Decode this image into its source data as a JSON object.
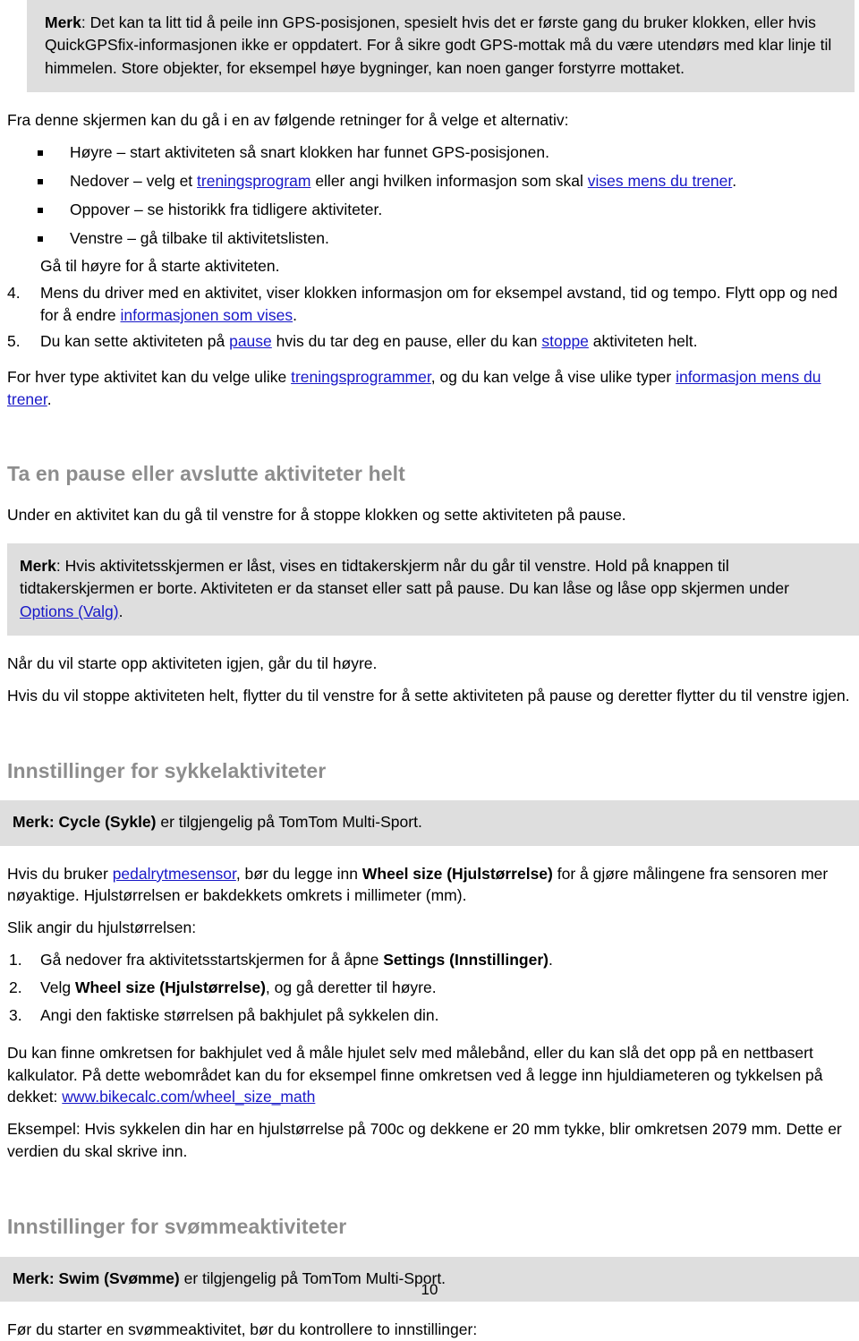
{
  "document": {
    "page_number": "10"
  },
  "note_gps": {
    "label": "Merk",
    "colon": ": ",
    "text": "Det kan ta litt tid å peile inn GPS-posisjonen, spesielt hvis det er første gang du bruker klokken, eller hvis QuickGPSfix-informasjonen ikke er oppdatert. For å sikre godt GPS-mottak må du være utendørs med klar linje til himmelen. Store objekter, for eksempel høye bygninger, kan noen ganger forstyrre mottaket."
  },
  "directions": {
    "intro": "Fra denne skjermen kan du gå i en av følgende retninger for å velge et alternativ:",
    "items": [
      {
        "pre": "Høyre – start aktiviteten så snart klokken har funnet GPS-posisjonen.",
        "link1": "",
        "mid": "",
        "link2": "",
        "post": ""
      },
      {
        "pre": "Nedover – velg et ",
        "link1": "treningsprogram",
        "mid": " eller angi hvilken informasjon som skal ",
        "link2": "vises mens du trener",
        "post": "."
      },
      {
        "pre": "Oppover – se historikk fra tidligere aktiviteter.",
        "link1": "",
        "mid": "",
        "link2": "",
        "post": ""
      },
      {
        "pre": "Venstre – gå tilbake til aktivitetslisten.",
        "link1": "",
        "mid": "",
        "link2": "",
        "post": ""
      }
    ],
    "closing": "Gå til høyre for å starte aktiviteten."
  },
  "steps": [
    {
      "number": "4.",
      "pre": "Mens du driver med en aktivitet, viser klokken informasjon om for eksempel avstand, tid og tempo. Flytt opp og ned for å endre ",
      "link1": "informasjonen som vises",
      "mid": "",
      "link2": "",
      "post": "."
    },
    {
      "number": "5.",
      "pre": "Du kan sette aktiviteten på ",
      "link1": "pause",
      "mid": " hvis du tar deg en pause, eller du kan ",
      "link2": "stoppe",
      "post": " aktiviteten helt."
    }
  ],
  "programs_para": {
    "pre": "For hver type aktivitet kan du velge ulike ",
    "link1": "treningsprogrammer",
    "mid": ", og du kan velge å vise ulike typer ",
    "link2": "informasjon mens du trener",
    "post": "."
  },
  "pause_section": {
    "heading": "Ta en pause eller avslutte aktiviteter helt",
    "intro": "Under en aktivitet kan du gå til venstre for å stoppe klokken og sette aktiviteten på pause.",
    "note": {
      "label": "Merk",
      "colon": ": ",
      "pre": "Hvis aktivitetsskjermen er låst, vises en tidtakerskjerm når du går til venstre. Hold på knappen til tidtakerskjermen er borte. Aktiviteten er da stanset eller satt på pause. Du kan låse og låse opp skjermen under ",
      "link": "Options (Valg)",
      "post": "."
    },
    "resume": "Når du vil starte opp aktiviteten igjen, går du til høyre.",
    "stop": "Hvis du vil stoppe aktiviteten helt, flytter du til venstre for å sette aktiviteten på pause og deretter flytter du til venstre igjen."
  },
  "bike_section": {
    "heading": "Innstillinger for sykkelaktiviteter",
    "note": {
      "label": "Merk: ",
      "bold_term": "Cycle (Sykle)",
      "rest": " er tilgjengelig på TomTom Multi-Sport."
    },
    "intro": {
      "pre": "Hvis du bruker ",
      "link": "pedalrytmesensor",
      "mid": ", bør du legge inn ",
      "bold_term": "Wheel size (Hjulstørrelse)",
      "post": " for å gjøre målingene fra sensoren mer nøyaktige. Hjulstørrelsen er bakdekkets omkrets i millimeter (mm)."
    },
    "howto_label": "Slik angir du hjulstørrelsen:",
    "steps": [
      {
        "number": "1.",
        "pre": "Gå nedover fra aktivitetsstartskjermen for å åpne ",
        "bold_term": "Settings (Innstillinger)",
        "post": "."
      },
      {
        "number": "2.",
        "pre": "Velg ",
        "bold_term": "Wheel size (Hjulstørrelse)",
        "post": ", og gå deretter til høyre."
      },
      {
        "number": "3.",
        "pre": "Angi den faktiske størrelsen på bakhjulet på sykkelen din.",
        "bold_term": "",
        "post": ""
      }
    ],
    "calculator": {
      "pre": "Du kan finne omkretsen for bakhjulet ved å måle hjulet selv med målebånd, eller du kan slå det opp på en nettbasert kalkulator. På dette webområdet kan du for eksempel finne omkretsen ved å legge inn hjuldiameteren og tykkelsen på dekket: ",
      "link": "www.bikecalc.com/wheel_size_math",
      "post": ""
    },
    "example": "Eksempel: Hvis sykkelen din har en hjulstørrelse på 700c og dekkene er 20 mm tykke, blir omkretsen 2079 mm. Dette er verdien du skal skrive inn."
  },
  "swim_section": {
    "heading": "Innstillinger for svømmeaktiviteter",
    "note": {
      "label": "Merk: ",
      "bold_term": "Swim (Svømme)",
      "rest": " er tilgjengelig på TomTom Multi-Sport."
    },
    "intro": "Før du starter en svømmeaktivitet, bør du kontrollere to innstillinger:"
  },
  "colors": {
    "note_background": "#dedede",
    "heading_gray": "#8d8d8d",
    "link_blue": "#1818c8",
    "text_black": "#000000"
  }
}
